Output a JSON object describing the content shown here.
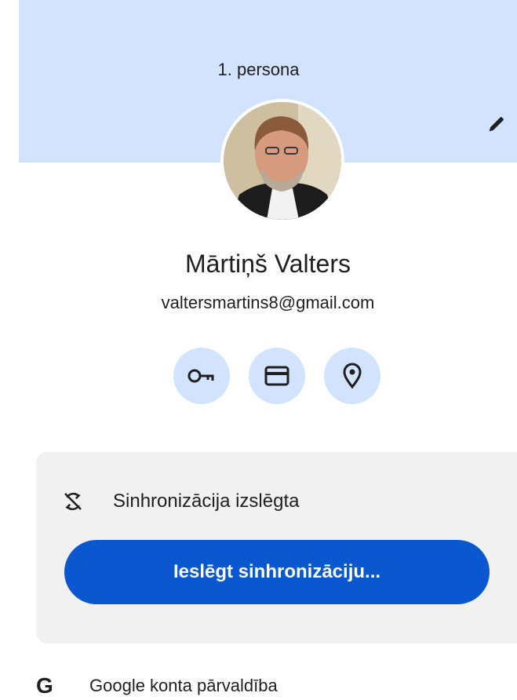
{
  "header": {
    "profile_title": "1. persona",
    "band_color": "#d3e3fd"
  },
  "user": {
    "name": "Mārtiņš Valters",
    "email": "valtersmartins8@gmail.com"
  },
  "quick_actions": [
    {
      "icon": "key-icon"
    },
    {
      "icon": "credit-card-icon"
    },
    {
      "icon": "location-pin-icon"
    }
  ],
  "sync": {
    "status_label": "Sinhronizācija izslēgta",
    "button_label": "Ieslēgt sinhronizāciju...",
    "button_color": "#0b57d0"
  },
  "google_account": {
    "logo_letter": "G",
    "label": "Google konta pārvaldība"
  }
}
